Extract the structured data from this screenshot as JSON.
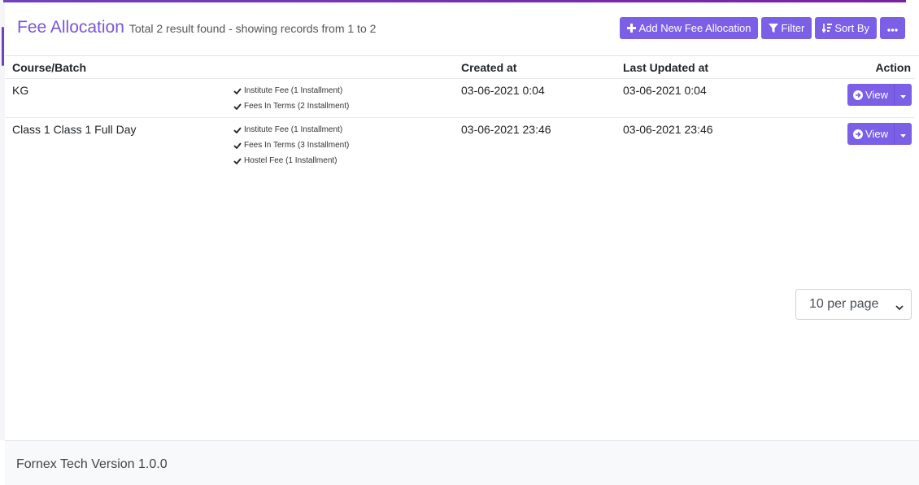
{
  "header": {
    "title": "Fee Allocation",
    "subtitle": "Total 2 result found - showing records from 1 to 2"
  },
  "toolbar": {
    "add_label": "Add New Fee Allocation",
    "filter_label": "Filter",
    "sort_label": "Sort By",
    "more_icon": "ellipsis-icon"
  },
  "table": {
    "columns": [
      "Course/Batch",
      "",
      "Created at",
      "Last Updated at",
      "Action"
    ],
    "rows": [
      {
        "course": "KG",
        "fees": [
          "Institute Fee (1 Installment)",
          "Fees In Terms (2 Installment)"
        ],
        "created": "03-06-2021 0:04",
        "updated": "03-06-2021 0:04",
        "action": "View"
      },
      {
        "course": "Class 1 Class 1 Full Day",
        "fees": [
          "Institute Fee (1 Installment)",
          "Fees In Terms (3 Installment)",
          "Hostel Fee (1 Installment)"
        ],
        "created": "03-06-2021 23:46",
        "updated": "03-06-2021 23:46",
        "action": "View"
      }
    ]
  },
  "pagination": {
    "per_page": "10 per page"
  },
  "footer": {
    "text": "Fornex Tech Version 1.0.0"
  },
  "colors": {
    "accent": "#7b5fe6",
    "title": "#7b55d6"
  }
}
